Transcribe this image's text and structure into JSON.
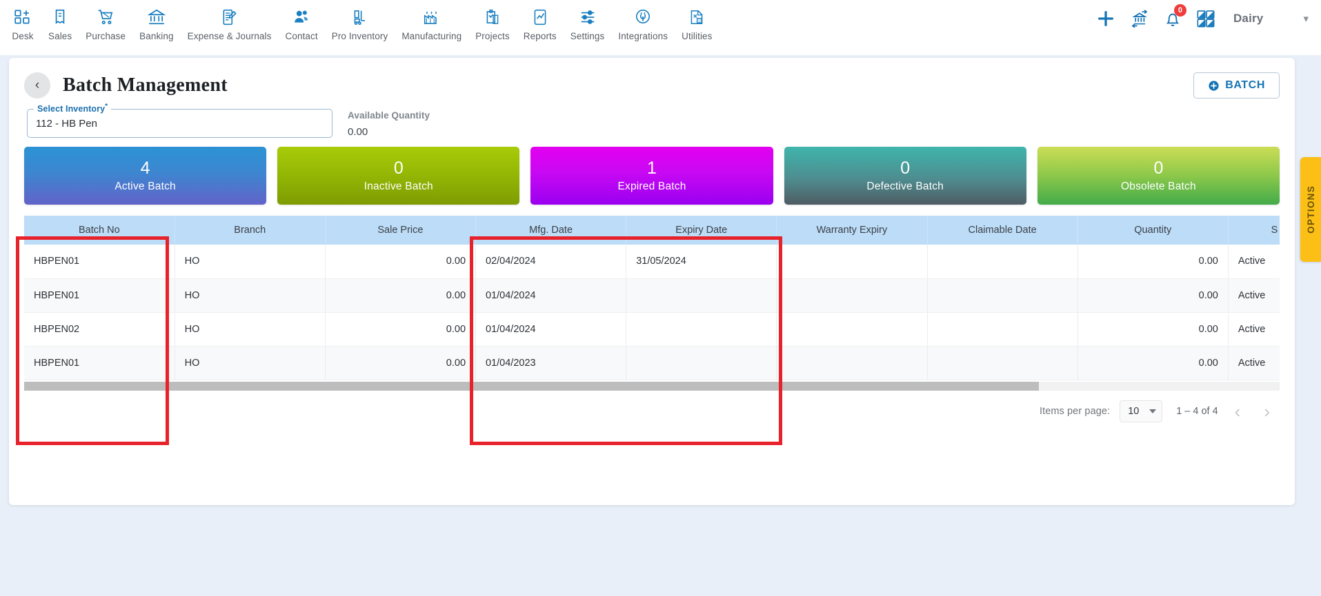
{
  "topnav": {
    "items": [
      {
        "label": "Desk",
        "icon": "desk-grid-plus-icon"
      },
      {
        "label": "Sales",
        "icon": "sales-receipt-icon"
      },
      {
        "label": "Purchase",
        "icon": "purchase-cart-icon"
      },
      {
        "label": "Banking",
        "icon": "banking-bank-icon"
      },
      {
        "label": "Expense & Journals",
        "icon": "journal-book-pen-icon"
      },
      {
        "label": "Contact",
        "icon": "contact-people-icon"
      },
      {
        "label": "Pro Inventory",
        "icon": "pro-inventory-forklift-icon"
      },
      {
        "label": "Manufacturing",
        "icon": "manufacturing-factory-icon"
      },
      {
        "label": "Projects",
        "icon": "projects-clipboard-icon"
      },
      {
        "label": "Reports",
        "icon": "reports-chart-icon"
      },
      {
        "label": "Settings",
        "icon": "settings-sliders-icon"
      },
      {
        "label": "Integrations",
        "icon": "integrations-plug-icon"
      },
      {
        "label": "Utilities",
        "icon": "utilities-tools-icon"
      }
    ],
    "right": {
      "add_icon": "plus-icon",
      "transfer_icon": "bank-transfer-icon",
      "notifications_icon": "bell-icon",
      "notifications_count": "0",
      "apps_icon": "apps-grid-icon",
      "org_name": "Dairy",
      "org_caret_icon": "chevron-down-icon"
    }
  },
  "page": {
    "back_icon": "chevron-left-icon",
    "title": "Batch Management",
    "batch_button": {
      "label": "BATCH",
      "icon": "plus-circle-icon"
    }
  },
  "form": {
    "select_inventory": {
      "label": "Select Inventory",
      "required_mark": "*",
      "value": "112 - HB Pen"
    },
    "available_quantity": {
      "label": "Available Quantity",
      "value": "0.00"
    }
  },
  "stats": [
    {
      "value": "4",
      "label": "Active Batch",
      "accent": "#3d86d0"
    },
    {
      "value": "0",
      "label": "Inactive Batch",
      "accent": "#93b605"
    },
    {
      "value": "1",
      "label": "Expired Batch",
      "accent": "#c808f3"
    },
    {
      "value": "0",
      "label": "Defective Batch",
      "accent": "#4e8d90"
    },
    {
      "value": "0",
      "label": "Obsolete Batch",
      "accent": "#8cc84a"
    }
  ],
  "table": {
    "columns": [
      "Batch No",
      "Branch",
      "Sale Price",
      "Mfg. Date",
      "Expiry Date",
      "Warranty Expiry",
      "Claimable Date",
      "Quantity",
      "S"
    ],
    "rows": [
      {
        "batch_no": "HBPEN01",
        "branch": "HO",
        "sale_price": "0.00",
        "mfg_date": "02/04/2024",
        "expiry_date": "31/05/2024",
        "warranty_expiry": "",
        "claimable_date": "",
        "quantity": "0.00",
        "status": "Active"
      },
      {
        "batch_no": "HBPEN01",
        "branch": "HO",
        "sale_price": "0.00",
        "mfg_date": "01/04/2024",
        "expiry_date": "",
        "warranty_expiry": "",
        "claimable_date": "",
        "quantity": "0.00",
        "status": "Active"
      },
      {
        "batch_no": "HBPEN02",
        "branch": "HO",
        "sale_price": "0.00",
        "mfg_date": "01/04/2024",
        "expiry_date": "",
        "warranty_expiry": "",
        "claimable_date": "",
        "quantity": "0.00",
        "status": "Active"
      },
      {
        "batch_no": "HBPEN01",
        "branch": "HO",
        "sale_price": "0.00",
        "mfg_date": "01/04/2023",
        "expiry_date": "",
        "warranty_expiry": "",
        "claimable_date": "",
        "quantity": "0.00",
        "status": "Active"
      }
    ]
  },
  "paginator": {
    "items_per_page_label": "Items per page:",
    "items_per_page_value": "10",
    "range_label": "1 – 4 of 4",
    "prev_icon": "chevron-left-icon",
    "next_icon": "chevron-right-icon"
  },
  "options_tab": {
    "label": "OPTIONS",
    "color": "#fcbf16"
  },
  "annotations": {
    "highlight_color": "#e8222a"
  }
}
